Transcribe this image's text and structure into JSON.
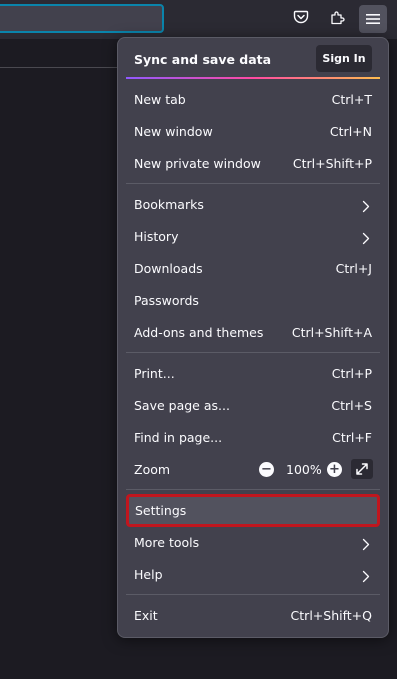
{
  "icons": {
    "pocket": "pocket-icon",
    "extensions": "extensions-icon",
    "menu": "hamburger-menu-icon",
    "chevron": "chevron-right-icon",
    "fullscreen": "fullscreen-icon"
  },
  "colors": {
    "panel_bg": "#42414d",
    "toolbar_bg": "#2b2a33",
    "highlight_border": "#c0161e",
    "urlbar_focus": "#0a84ab"
  },
  "menu": {
    "sync_label": "Sync and save data",
    "sign_in": "Sign In",
    "items": {
      "new_tab": {
        "label": "New tab",
        "shortcut": "Ctrl+T"
      },
      "new_window": {
        "label": "New window",
        "shortcut": "Ctrl+N"
      },
      "new_private_window": {
        "label": "New private window",
        "shortcut": "Ctrl+Shift+P"
      },
      "bookmarks": {
        "label": "Bookmarks"
      },
      "history": {
        "label": "History"
      },
      "downloads": {
        "label": "Downloads",
        "shortcut": "Ctrl+J"
      },
      "passwords": {
        "label": "Passwords"
      },
      "addons": {
        "label": "Add-ons and themes",
        "shortcut": "Ctrl+Shift+A"
      },
      "print": {
        "label": "Print...",
        "shortcut": "Ctrl+P"
      },
      "save_page": {
        "label": "Save page as...",
        "shortcut": "Ctrl+S"
      },
      "find": {
        "label": "Find in page...",
        "shortcut": "Ctrl+F"
      },
      "zoom": {
        "label": "Zoom",
        "minus": "−",
        "value": "100%",
        "plus": "+"
      },
      "settings": {
        "label": "Settings"
      },
      "more_tools": {
        "label": "More tools"
      },
      "help": {
        "label": "Help"
      },
      "exit": {
        "label": "Exit",
        "shortcut": "Ctrl+Shift+Q"
      }
    }
  }
}
